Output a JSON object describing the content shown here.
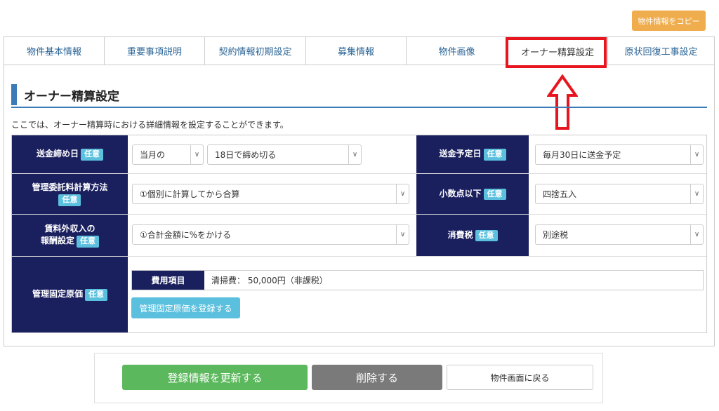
{
  "copy_button": "物件情報をコピー",
  "tabs": [
    {
      "label": "物件基本情報"
    },
    {
      "label": "重要事項説明"
    },
    {
      "label": "契約情報初期設定"
    },
    {
      "label": "募集情報"
    },
    {
      "label": "物件画像"
    },
    {
      "label": "オーナー精算設定",
      "active": true
    },
    {
      "label": "原状回復工事設定"
    }
  ],
  "section": {
    "title": "オーナー精算設定",
    "description": "ここでは、オーナー精算時における詳細情報を設定することができます。"
  },
  "badge": "任意",
  "form": {
    "remit_close": {
      "label": "送金締め日",
      "month": "当月の",
      "day": "18日で締め切る"
    },
    "remit_date": {
      "label": "送金予定日",
      "value": "毎月30日に送金予定"
    },
    "commission": {
      "label": "管理委託料計算方法",
      "value": "①個別に計算してから合算"
    },
    "decimal": {
      "label": "小数点以下",
      "value": "四捨五入"
    },
    "extra_income": {
      "label_line1": "賃料外収入の",
      "label_line2": "報酬設定",
      "value": "①合計金額に%をかける"
    },
    "tax": {
      "label": "消費税",
      "value": "別途税"
    },
    "fixed_cost": {
      "label": "管理固定原価",
      "head": "費用項目",
      "value": "清掃費： 50,000円（非課税）",
      "register_button": "管理固定原価を登録する"
    }
  },
  "buttons": {
    "update": "登録情報を更新する",
    "delete": "削除する",
    "back": "物件画面に戻る"
  },
  "colors": {
    "label_bg": "#1a1f5e",
    "badge": "#5bc0de",
    "highlight": "#e8141e",
    "accent": "#3a7bb8"
  }
}
